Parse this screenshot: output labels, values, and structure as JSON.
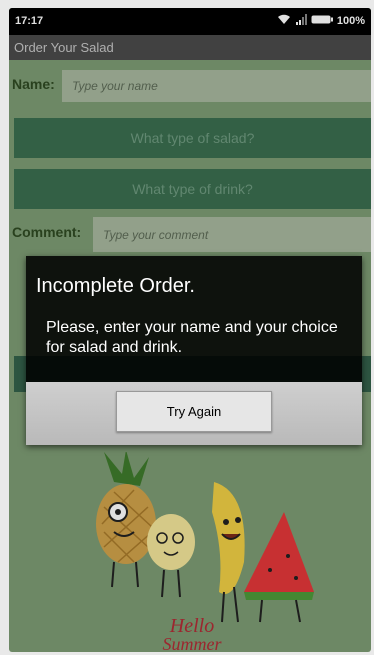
{
  "status_bar": {
    "time": "17:17",
    "battery_label": "100%"
  },
  "app": {
    "title": "Order Your Salad"
  },
  "form": {
    "name_label": "Name:",
    "name_placeholder": "Type your name",
    "salad_button": "What type of salad?",
    "drink_button": "What type of drink?",
    "comment_label": "Comment:",
    "comment_placeholder": "Type your comment"
  },
  "illustration": {
    "caption_line1": "Hello",
    "caption_line2": "Summer"
  },
  "dialog": {
    "title": "Incomplete Order.",
    "message": "Please, enter your name and your choice for salad and drink.",
    "button": "Try Again"
  },
  "colors": {
    "app_background": "#7d9b73",
    "button_green": "#3b6e4f",
    "dialog_background": "#1a1a1a"
  }
}
